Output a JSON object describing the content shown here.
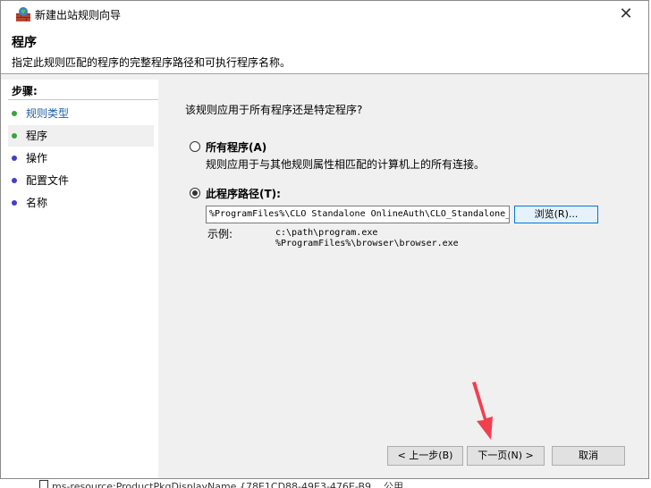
{
  "window": {
    "title": "新建出站规则向导",
    "close_glyph": "✕"
  },
  "header": {
    "title": "程序",
    "subtitle": "指定此规则匹配的程序的完整程序路径和可执行程序名称。"
  },
  "steps": {
    "title": "步骤:",
    "items": [
      {
        "label": "规则类型",
        "state": "done"
      },
      {
        "label": "程序",
        "state": "current"
      },
      {
        "label": "操作",
        "state": "todo"
      },
      {
        "label": "配置文件",
        "state": "todo"
      },
      {
        "label": "名称",
        "state": "todo"
      }
    ]
  },
  "content": {
    "question": "该规则应用于所有程序还是特定程序?",
    "all_programs": {
      "label": "所有程序(A)",
      "description": "规则应用于与其他规则属性相匹配的计算机上的所有连接。",
      "selected": false
    },
    "this_program": {
      "label": "此程序路径(T):",
      "selected": true,
      "path_value": "%ProgramFiles%\\CLO Standalone OnlineAuth\\CLO_Standalone_",
      "browse_label": "浏览(R)..."
    },
    "example": {
      "label": "示例:",
      "line1": "c:\\path\\program.exe",
      "line2": "%ProgramFiles%\\browser\\browser.exe"
    }
  },
  "buttons": {
    "back": "< 上一步(B)",
    "next": "下一页(N) >",
    "cancel": "取消"
  },
  "background_row": {
    "text": "ms-resource:ProductPkgDisplayName   {78E1CD88-49E3-476E-B9...   公用"
  },
  "colors": {
    "done_dot": "#3aa33a",
    "todo_dot": "#4040c8",
    "arrow": "#f04050"
  }
}
